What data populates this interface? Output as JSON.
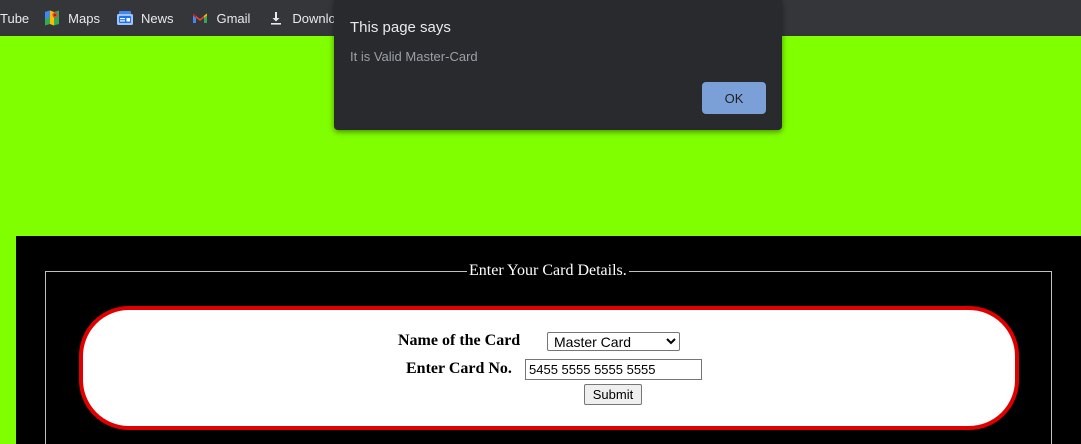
{
  "bookmarks": [
    {
      "label": "Tube",
      "icon": "youtube-icon"
    },
    {
      "label": "Maps",
      "icon": "maps-icon"
    },
    {
      "label": "News",
      "icon": "news-icon"
    },
    {
      "label": "Gmail",
      "icon": "gmail-icon"
    },
    {
      "label": "Downloads",
      "icon": "download-icon"
    }
  ],
  "dialog": {
    "title": "This page says",
    "message": "It is Valid Master-Card",
    "ok_label": "OK"
  },
  "form": {
    "legend": "Enter Your Card Details.",
    "name_label": "Name of the Card",
    "card_type_selected": "Master Card",
    "card_no_label": "Enter Card No.",
    "card_no_value": "5455 5555 5555 5555",
    "submit_label": "Submit"
  },
  "colors": {
    "page_background": "#80ff00",
    "panel_background": "#000000",
    "form_border": "#e00000",
    "dialog_background": "#292a2d",
    "ok_button": "#7ba0d8",
    "bookmarks_bar": "#35363a"
  }
}
